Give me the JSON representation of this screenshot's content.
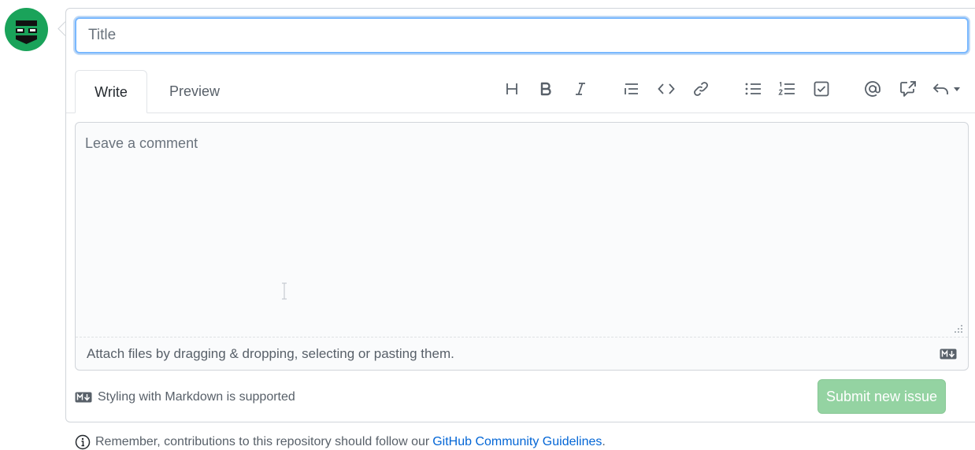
{
  "avatar": {
    "icon": "identicon-avatar",
    "color": "#1aa35a"
  },
  "form": {
    "title_placeholder": "Title",
    "title_value": "",
    "comment_placeholder": "Leave a comment",
    "comment_value": ""
  },
  "tabs": [
    {
      "label": "Write",
      "active": true
    },
    {
      "label": "Preview",
      "active": false
    }
  ],
  "toolbar": [
    {
      "icon": "heading-icon"
    },
    {
      "icon": "bold-icon"
    },
    {
      "icon": "italic-icon"
    },
    {
      "icon": "quote-icon"
    },
    {
      "icon": "code-icon"
    },
    {
      "icon": "link-icon"
    },
    {
      "icon": "unordered-list-icon"
    },
    {
      "icon": "ordered-list-icon"
    },
    {
      "icon": "task-list-icon"
    },
    {
      "icon": "mention-icon"
    },
    {
      "icon": "cross-reference-icon"
    },
    {
      "icon": "saved-replies-icon"
    }
  ],
  "attach": {
    "text": "Attach files by dragging & dropping, selecting or pasting them."
  },
  "markdown_note": "Styling with Markdown is supported",
  "submit": {
    "label": "Submit new issue",
    "enabled": false,
    "color": "#94d3a2"
  },
  "reminder": {
    "text": "Remember, contributions to this repository should follow our",
    "link": "GitHub Community Guidelines",
    "suffix": "."
  },
  "colors": {
    "link": "#0366d6",
    "focus_border": "#79b8ff",
    "border": "#d1d5da"
  }
}
